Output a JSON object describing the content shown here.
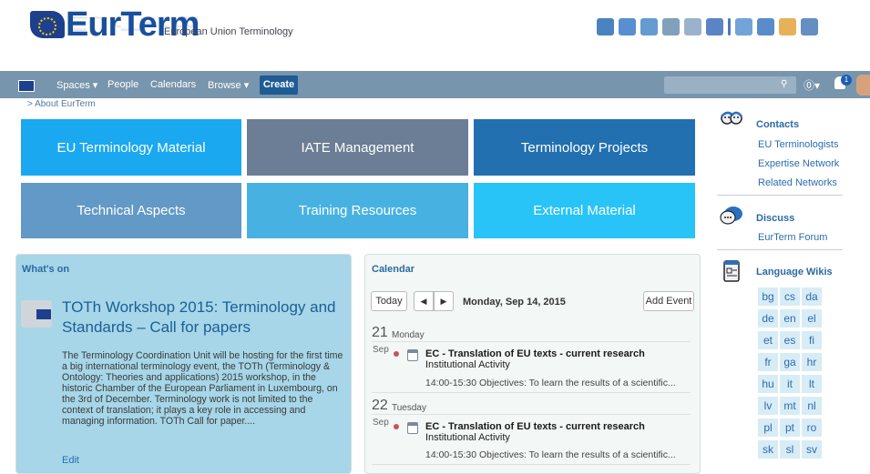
{
  "header": {
    "logo_text": "EurTerm",
    "logo_subtitle": "European Union Terminology",
    "icon_colors": [
      "#2c6db5",
      "#3a7bc8",
      "#4a89c8",
      "#6a8fb0",
      "#8aa4c4",
      "#3d6fb8",
      "#2c62b0",
      "#5a93d1",
      "#3d78c0",
      "#e3a33c",
      "#4a7ab8"
    ]
  },
  "navbar": {
    "spaces": "Spaces ▾",
    "people": "People",
    "calendars": "Calendars",
    "browse": "Browse ▾",
    "create": "Create",
    "help": "⓪▾",
    "notif_count": "1"
  },
  "breadcrumb": "> About EurTerm",
  "tiles": [
    {
      "label": "EU Terminology Material",
      "color": "#1aa8f1"
    },
    {
      "label": "IATE Management",
      "color": "#6c7e95"
    },
    {
      "label": "Terminology Projects",
      "color": "#2270b0"
    },
    {
      "label": "Technical Aspects",
      "color": "#6299c6"
    },
    {
      "label": "Training Resources",
      "color": "#47b2e2"
    },
    {
      "label": "External Material",
      "color": "#28c3f7"
    }
  ],
  "whats_on": {
    "title": "What's on",
    "news_title": "TOTh Workshop 2015: Terminology and Standards – Call for papers",
    "news_body": "The Terminology Coordination Unit will be hosting for the first time a big international terminology event, the TOTh (Terminology & Ontology: Theories and applications) 2015 workshop, in the historic Chamber of the European Parliament in Luxembourg, on the 3rd of December. Terminology work is not limited to the context of translation; it plays a key role in accessing and managing information. TOTh Call for paper....",
    "edit": "Edit"
  },
  "calendar": {
    "title": "Calendar",
    "today": "Today",
    "prev": "◀",
    "next": "▶",
    "current_date": "Monday, Sep 14, 2015",
    "add_event": "Add Event",
    "days": [
      {
        "num": "21",
        "name": "Monday",
        "month": "Sep",
        "event_title": "EC - Translation of EU texts - current research",
        "event_type": "Institutional Activity",
        "event_desc": "14:00-15:30 Objectives: To learn the results of a scientific..."
      },
      {
        "num": "22",
        "name": "Tuesday",
        "month": "Sep",
        "event_title": "EC - Translation of EU texts - current research",
        "event_type": "Institutional Activity",
        "event_desc": "14:00-15:30 Objectives: To learn the results of a scientific..."
      }
    ]
  },
  "sidebar": {
    "contacts_head": "Contacts",
    "contacts": [
      "EU Terminologists",
      "Expertise Network",
      "Related Networks"
    ],
    "discuss_head": "Discuss",
    "discuss": [
      "EurTerm Forum"
    ],
    "wikis_head": "Language Wikis",
    "languages": [
      "bg",
      "cs",
      "da",
      "de",
      "en",
      "el",
      "et",
      "es",
      "fi",
      "fr",
      "ga",
      "hr",
      "hu",
      "it",
      "lt",
      "lv",
      "mt",
      "nl",
      "pl",
      "pt",
      "ro",
      "sk",
      "sl",
      "sv"
    ]
  }
}
